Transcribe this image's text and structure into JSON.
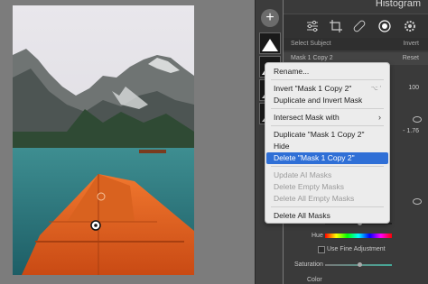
{
  "panel": {
    "title": "Histogram",
    "select_subject": "Select Subject",
    "invert": "Invert",
    "mask_name": "Mask 1 Copy 2",
    "reset": "Reset",
    "amount": "100",
    "value_176": "- 1.76",
    "hue_label": "Hue",
    "fine_adjust": "Use Fine Adjustment",
    "saturation_label": "Saturation",
    "color_label": "Color"
  },
  "masks": {
    "add_label": "+"
  },
  "menu": {
    "items": [
      {
        "label": "Rename...",
        "shortcut": "",
        "disabled": false,
        "selected": false,
        "submenu": false
      },
      {
        "label": "Invert \"Mask 1 Copy 2\"",
        "shortcut": "⌥ ′",
        "disabled": false,
        "selected": false,
        "submenu": false
      },
      {
        "label": "Duplicate and Invert Mask",
        "shortcut": "",
        "disabled": false,
        "selected": false,
        "submenu": false
      },
      {
        "label": "Intersect Mask with",
        "shortcut": "",
        "disabled": false,
        "selected": false,
        "submenu": true
      },
      {
        "label": "Duplicate \"Mask 1 Copy 2\"",
        "shortcut": "",
        "disabled": false,
        "selected": false,
        "submenu": false
      },
      {
        "label": "Hide",
        "shortcut": "",
        "disabled": false,
        "selected": false,
        "submenu": false
      },
      {
        "label": "Delete \"Mask 1 Copy 2\"",
        "shortcut": "",
        "disabled": false,
        "selected": true,
        "submenu": false
      },
      {
        "label": "Update AI Masks",
        "shortcut": "",
        "disabled": true,
        "selected": false,
        "submenu": false
      },
      {
        "label": "Delete Empty Masks",
        "shortcut": "",
        "disabled": true,
        "selected": false,
        "submenu": false
      },
      {
        "label": "Delete All Empty Masks",
        "shortcut": "",
        "disabled": true,
        "selected": false,
        "submenu": false
      },
      {
        "label": "Delete All Masks",
        "shortcut": "",
        "disabled": false,
        "selected": false,
        "submenu": false
      }
    ],
    "highlight_color": "#2f6fd6"
  },
  "icons": {
    "tools": [
      "sliders-icon",
      "crop-icon",
      "healing-icon",
      "mask-icon",
      "gear-icon"
    ]
  }
}
